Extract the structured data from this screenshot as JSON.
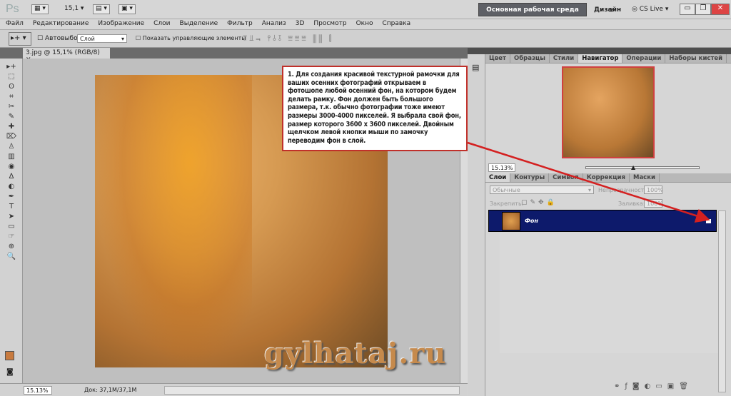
{
  "app": {
    "logo": "Ps",
    "zoom": "15,1",
    "workspace": "Основная рабочая среда",
    "design": "Дизайн",
    "more": "»",
    "cslive": "CS Live ▾",
    "colors": {
      "accent": "#0d1a6b",
      "callout_border": "#c0302a"
    }
  },
  "menu": [
    "Файл",
    "Редактирование",
    "Изображение",
    "Слои",
    "Выделение",
    "Фильтр",
    "Анализ",
    "3D",
    "Просмотр",
    "Окно",
    "Справка"
  ],
  "options": {
    "autoselect_label": "Автовыбор:",
    "autoselect_value": "Слой",
    "show_controls": "Показать управляющие элементы"
  },
  "document": {
    "tab": "3.jpg @ 15,1% (RGB/8)",
    "close": "✕",
    "zoom": "15.13%",
    "doc_info": "Док: 37,1M/37,1M"
  },
  "tools": [
    "▸+",
    "⬚",
    "ʘ",
    "⌗",
    "✂",
    "✎",
    "✚",
    "⌦",
    "♙",
    "▥",
    "◉",
    "∆",
    "◐",
    "✒",
    "T",
    "➤",
    "▭",
    "☞",
    "⊕",
    "🔍"
  ],
  "callout": "1. Для создания красивой текстурной рамочки для ваших осенних фотографий открываем в фотошопе  любой осенний фон, на котором будем делать рамку. Фон должен быть большого размера, т.к. обычно фотографии тоже имеют размеры 3000-4000 пикселей. Я выбрала свой фон, размер которого 3600 х 3600 пикселей. Двойным щелчком левой кнопки мыши по замочку переводим фон в слой.",
  "watermark": "gylhataj.ru",
  "nav_panel": {
    "tabs": [
      "Цвет",
      "Образцы",
      "Стили",
      "Навигатор",
      "Операции",
      "Наборы кистей"
    ],
    "active": 3,
    "zoom": "15.13%",
    "slider": 0.42
  },
  "layers_panel": {
    "tabs": [
      "Слои",
      "Контуры",
      "Символ",
      "Коррекция",
      "Маски"
    ],
    "blend_mode": "Обычные",
    "opacity_label": "Непрозрачность:",
    "opacity": "100%",
    "lock_label": "Закрепить:",
    "fill_label": "Заливка:",
    "fill": "100%",
    "layers": [
      {
        "name": "Фон",
        "visible": true,
        "locked": true
      }
    ],
    "bottom_icons": [
      "link-icon",
      "fx-icon",
      "mask-icon",
      "adjustment-icon",
      "group-icon",
      "new-layer-icon",
      "trash-icon"
    ]
  }
}
